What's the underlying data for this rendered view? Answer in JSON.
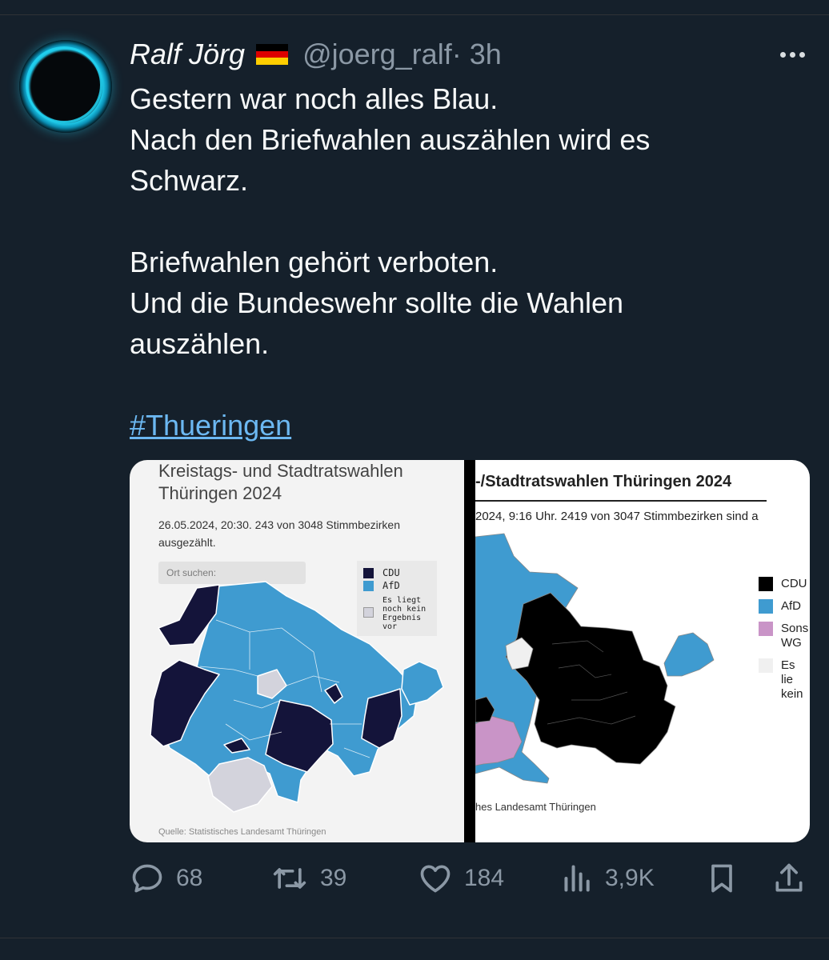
{
  "tweet": {
    "name": "Ralf Jörg",
    "flag": "🇩🇪",
    "handle": "@joerg_ralf",
    "time": "· 3h",
    "text": {
      "line1": "Gestern war noch alles Blau.",
      "line2": "Nach den Briefwahlen auszählen wird es",
      "line3": "Schwarz.",
      "line4": "Briefwahlen gehört verboten.",
      "line5": "Und die Bundeswehr sollte die Wahlen",
      "line6": "auszählen."
    },
    "hashtag": "#Thueringen"
  },
  "media": {
    "map1": {
      "title1": "Kreistags- und Stadtratswahlen",
      "title2": "Thüringen 2024",
      "subtitle": "26.05.2024, 20:30. 243 von 3048 Stimmbezirken ausgezählt.",
      "search_placeholder": "Ort suchen:",
      "legend": {
        "cdu": "CDU",
        "afd": "AfD",
        "none1": "Es liegt",
        "none2": "noch kein",
        "none3": "Ergebnis",
        "none4": "vor"
      },
      "source": "Quelle: Statistisches Landesamt Thüringen",
      "colors": {
        "cdu": "#14143a",
        "afd": "#3f9bd0",
        "none": "#d3d3dc"
      }
    },
    "map2": {
      "title": "-/Stadtratswahlen Thüringen 2024",
      "subtitle": "2024, 9:16 Uhr. 2419 von 3047 Stimmbezirken sind a",
      "legend": {
        "cdu": "CDU",
        "afd": "AfD",
        "sons1": "Sons",
        "sons2": "WG",
        "none1": "Es lie",
        "none2": "kein"
      },
      "source": "hes Landesamt Thüringen",
      "colors": {
        "cdu": "#000000",
        "afd": "#3f9bd0",
        "other": "#c994c7",
        "none": "#f0f0f0"
      }
    }
  },
  "actions": {
    "replies": "68",
    "retweets": "39",
    "likes": "184",
    "views": "3,9K"
  }
}
